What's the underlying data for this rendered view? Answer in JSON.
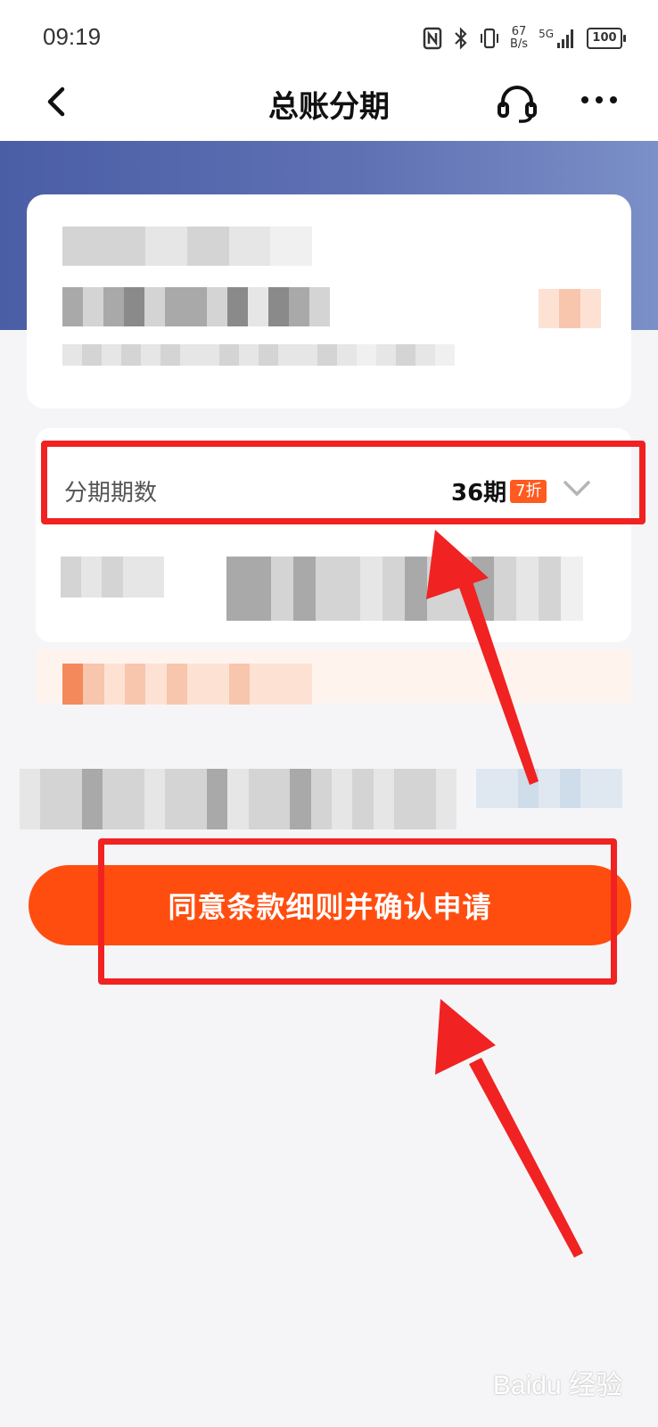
{
  "status_bar": {
    "time": "09:19",
    "network_speed_value": "67",
    "network_speed_unit": "B/s",
    "network_type": "5G",
    "battery": "100",
    "icons": [
      "nfc-icon",
      "bluetooth-icon",
      "vibrate-icon",
      "signal-icon",
      "battery-icon"
    ]
  },
  "nav": {
    "title": "总账分期",
    "icons": [
      "back-icon",
      "customer-service-icon",
      "more-icon"
    ]
  },
  "installment": {
    "label": "分期期数",
    "value": "36期",
    "discount": "7折"
  },
  "confirm_button_label": "同意条款细则并确认申请",
  "watermark": "Baidu 经验",
  "colors": {
    "banner": "#5a6cb0",
    "accent": "#ff4d0f",
    "annotation": "#f02222"
  }
}
